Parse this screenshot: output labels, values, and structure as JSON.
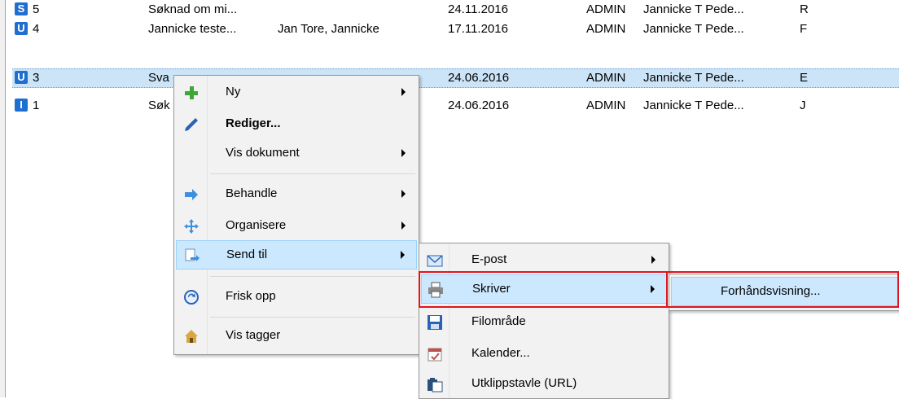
{
  "rows": [
    {
      "badge": "S",
      "num": "5",
      "title": "Søknad om mi...",
      "from": "",
      "date": "24.11.2016",
      "user": "ADMIN",
      "owner": "Jannicke T Pede...",
      "code": "R"
    },
    {
      "badge": "U",
      "num": "4",
      "title": "Jannicke teste...",
      "from": "Jan Tore, Jannicke",
      "date": "17.11.2016",
      "user": "ADMIN",
      "owner": "Jannicke T Pede...",
      "code": "F"
    },
    {
      "badge": "U",
      "num": "3",
      "title": "Sva",
      "from": "",
      "date": "24.06.2016",
      "user": "ADMIN",
      "owner": "Jannicke T Pede...",
      "code": "E"
    },
    {
      "badge": "I",
      "num": "1",
      "title": "Søk",
      "from": "",
      "date": "24.06.2016",
      "user": "ADMIN",
      "owner": "Jannicke T Pede...",
      "code": "J"
    }
  ],
  "context_menu": {
    "ny": "Ny",
    "rediger": "Rediger...",
    "vis_dokument": "Vis dokument",
    "behandle": "Behandle",
    "organisere": "Organisere",
    "send_til": "Send til",
    "frisk_opp": "Frisk opp",
    "vis_tagger": "Vis tagger"
  },
  "send_menu": {
    "epost": "E-post",
    "skriver": "Skriver",
    "filomrade": "Filområde",
    "kalender": "Kalender...",
    "utklipp": "Utklippstavle (URL)"
  },
  "printer_menu": {
    "forhandsvisning": "Forhåndsvisning..."
  },
  "colors": {
    "badge": "#1e6fd0",
    "selection": "#cce4f7",
    "menu_highlight": "#cce8ff",
    "annotation": "#e0141e"
  }
}
